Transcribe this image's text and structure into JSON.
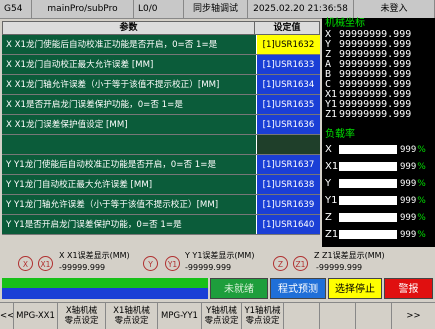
{
  "statusbar": {
    "code": "G54",
    "program": "mainPro/subPro",
    "level": "L0/0",
    "mode": "同步轴调试",
    "datetime": "2025.02.20  21:36:58",
    "login": "未登入"
  },
  "table": {
    "headers": {
      "param": "参数",
      "value": "设定值"
    },
    "rows": [
      {
        "label": "X X1龙门使能后自动校准正功能是否开启，0=否 1=是",
        "value": "[1]USR1632",
        "selected": true
      },
      {
        "label": "X X1龙门自动校正最大允许误差 [MM]",
        "value": "[1]USR1633"
      },
      {
        "label": "X X1龙门轴允许误差（小于等于该值不提示校正）[MM]",
        "value": "[1]USR1634"
      },
      {
        "label": "X X1是否开启龙门误差保护功能，0=否 1=是",
        "value": "[1]USR1635"
      },
      {
        "label": "X X1龙门误差保护值设定 [MM]",
        "value": "[1]USR1636"
      },
      {
        "label": "",
        "value": "",
        "blank": true
      },
      {
        "label": "Y Y1龙门使能后自动校准正功能是否开启，0=否 1=是",
        "value": "[1]USR1637"
      },
      {
        "label": "Y Y1龙门自动校正最大允许误差 [MM]",
        "value": "[1]USR1638"
      },
      {
        "label": "Y Y1龙门轴允许误差（小于等于该值不提示校正）[MM]",
        "value": "[1]USR1639"
      },
      {
        "label": "Y Y1是否开启龙门误差保护功能，0=否 1=是",
        "value": "[1]USR1640"
      }
    ]
  },
  "machine_coords": {
    "title": "机械坐标",
    "axes": [
      {
        "axis": "X",
        "value": "99999999.999"
      },
      {
        "axis": "Y",
        "value": "99999999.999"
      },
      {
        "axis": "Z",
        "value": "99999999.999"
      },
      {
        "axis": "A",
        "value": "99999999.999"
      },
      {
        "axis": "B",
        "value": "99999999.999"
      },
      {
        "axis": "C",
        "value": "99999999.999"
      },
      {
        "axis": "X1",
        "value": "99999999.999"
      },
      {
        "axis": "Y1",
        "value": "99999999.999"
      },
      {
        "axis": "Z1",
        "value": "99999999.999"
      }
    ]
  },
  "load_rate": {
    "title": "负载率",
    "axes": [
      {
        "axis": "X",
        "value": "999",
        "unit": "%"
      },
      {
        "axis": "X1",
        "value": "999",
        "unit": "%"
      },
      {
        "axis": "Y",
        "value": "999",
        "unit": "%"
      },
      {
        "axis": "Y1",
        "value": "999",
        "unit": "%"
      },
      {
        "axis": "Z",
        "value": "999",
        "unit": "%"
      },
      {
        "axis": "Z1",
        "value": "999",
        "unit": "%"
      }
    ]
  },
  "errors": [
    {
      "axis_a": "X",
      "axis_b": "X1",
      "label": "X X1误差显示(MM)",
      "value": "-99999.999"
    },
    {
      "axis_a": "Y",
      "axis_b": "Y1",
      "label": "Y Y1误差显示(MM)",
      "value": "-99999.999"
    },
    {
      "axis_a": "Z",
      "axis_b": "Z1",
      "label": "Z Z1误差显示(MM)",
      "value": "-99999.999"
    }
  ],
  "actions": {
    "not_ready": "未就绪",
    "program_preview": "程式预测",
    "select_stop": "选择停止",
    "alarm": "警报"
  },
  "bottom_nav": {
    "prev": "<<",
    "items": [
      {
        "line1": "MPG-XX1",
        "line2": ""
      },
      {
        "line1": "X轴机械",
        "line2": "零点设定"
      },
      {
        "line1": "X1轴机械",
        "line2": "零点设定"
      },
      {
        "line1": "MPG-YY1",
        "line2": ""
      },
      {
        "line1": "Y轴机械",
        "line2": "零点设定"
      },
      {
        "line1": "Y1轴机械",
        "line2": "零点设定"
      }
    ],
    "next": ">>"
  },
  "colors": {
    "row_bg": "#0b5c3a",
    "value_bg": "#1b3fd6",
    "selected_bg": "#ffff00",
    "panel_bg": "#000000",
    "accent_green": "#00e000",
    "error_red": "#b03030",
    "not_ready_bg": "#1e9e3c",
    "preview_bg": "#1f6fd8",
    "stop_bg": "#ffff00",
    "alarm_bg": "#e01010"
  }
}
